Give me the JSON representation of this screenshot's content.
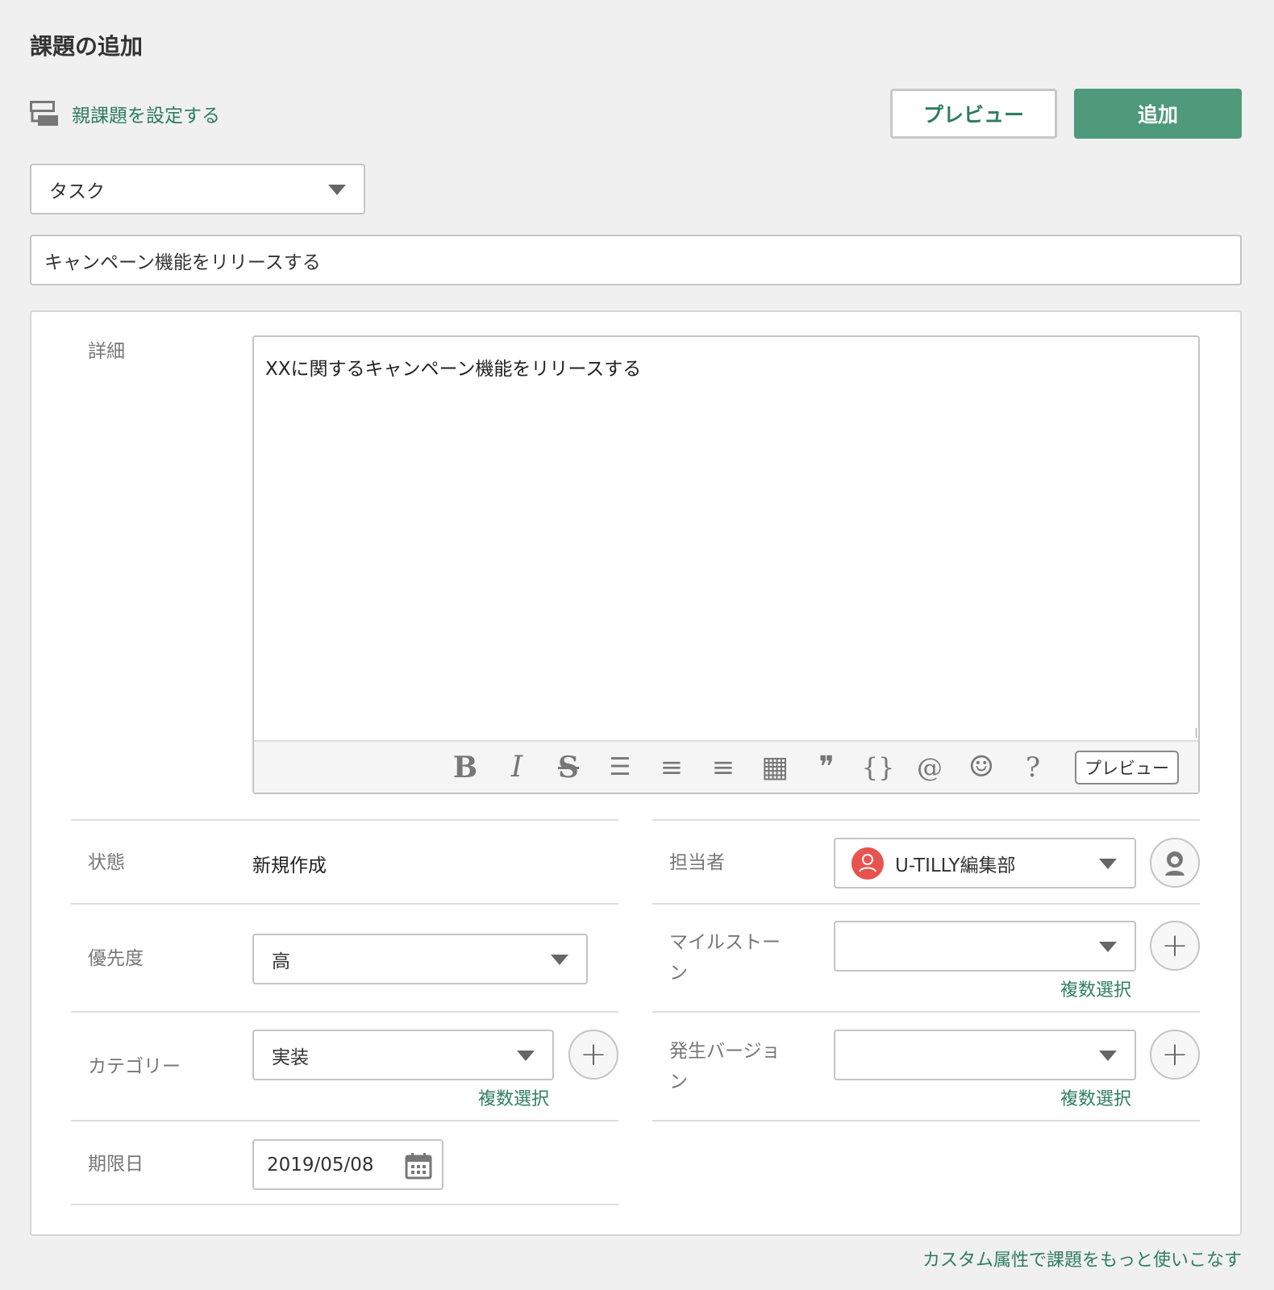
{
  "page_title": "課題の追加",
  "parent_link": "親課題を設定する",
  "buttons": {
    "preview": "プレビュー",
    "add": "追加"
  },
  "issue_type": "タスク",
  "summary": "キャンペーン機能をリリースする",
  "detail": {
    "label": "詳細",
    "text": "XXに関するキャンペーン機能をリリースする",
    "toolbar": {
      "bold": "B",
      "italic": "I",
      "strike": "S",
      "bullet": "☰",
      "numbered": "≡",
      "checklist": "≡",
      "table": "▦",
      "quote": "❞",
      "code": "{}",
      "link": "@",
      "emoji": "☺",
      "help": "?",
      "preview": "プレビュー"
    }
  },
  "fields": {
    "status": {
      "label": "状態",
      "value": "新規作成"
    },
    "priority": {
      "label": "優先度",
      "value": "高"
    },
    "category": {
      "label": "カテゴリー",
      "value": "実装",
      "multi": "複数選択"
    },
    "due_date": {
      "label": "期限日",
      "value": "2019/05/08"
    },
    "assignee": {
      "label": "担当者",
      "value": "U-TILLY編集部"
    },
    "milestone": {
      "label": "マイルストーン",
      "value": "",
      "multi": "複数選択"
    },
    "version": {
      "label": "発生バージョン",
      "value": "",
      "multi": "複数選択"
    }
  },
  "footer_link": "カスタム属性で課題をもっと使いこなす",
  "colors": {
    "accent": "#4e9a7a",
    "link": "#2e7d62",
    "avatar": "#e8534f"
  }
}
